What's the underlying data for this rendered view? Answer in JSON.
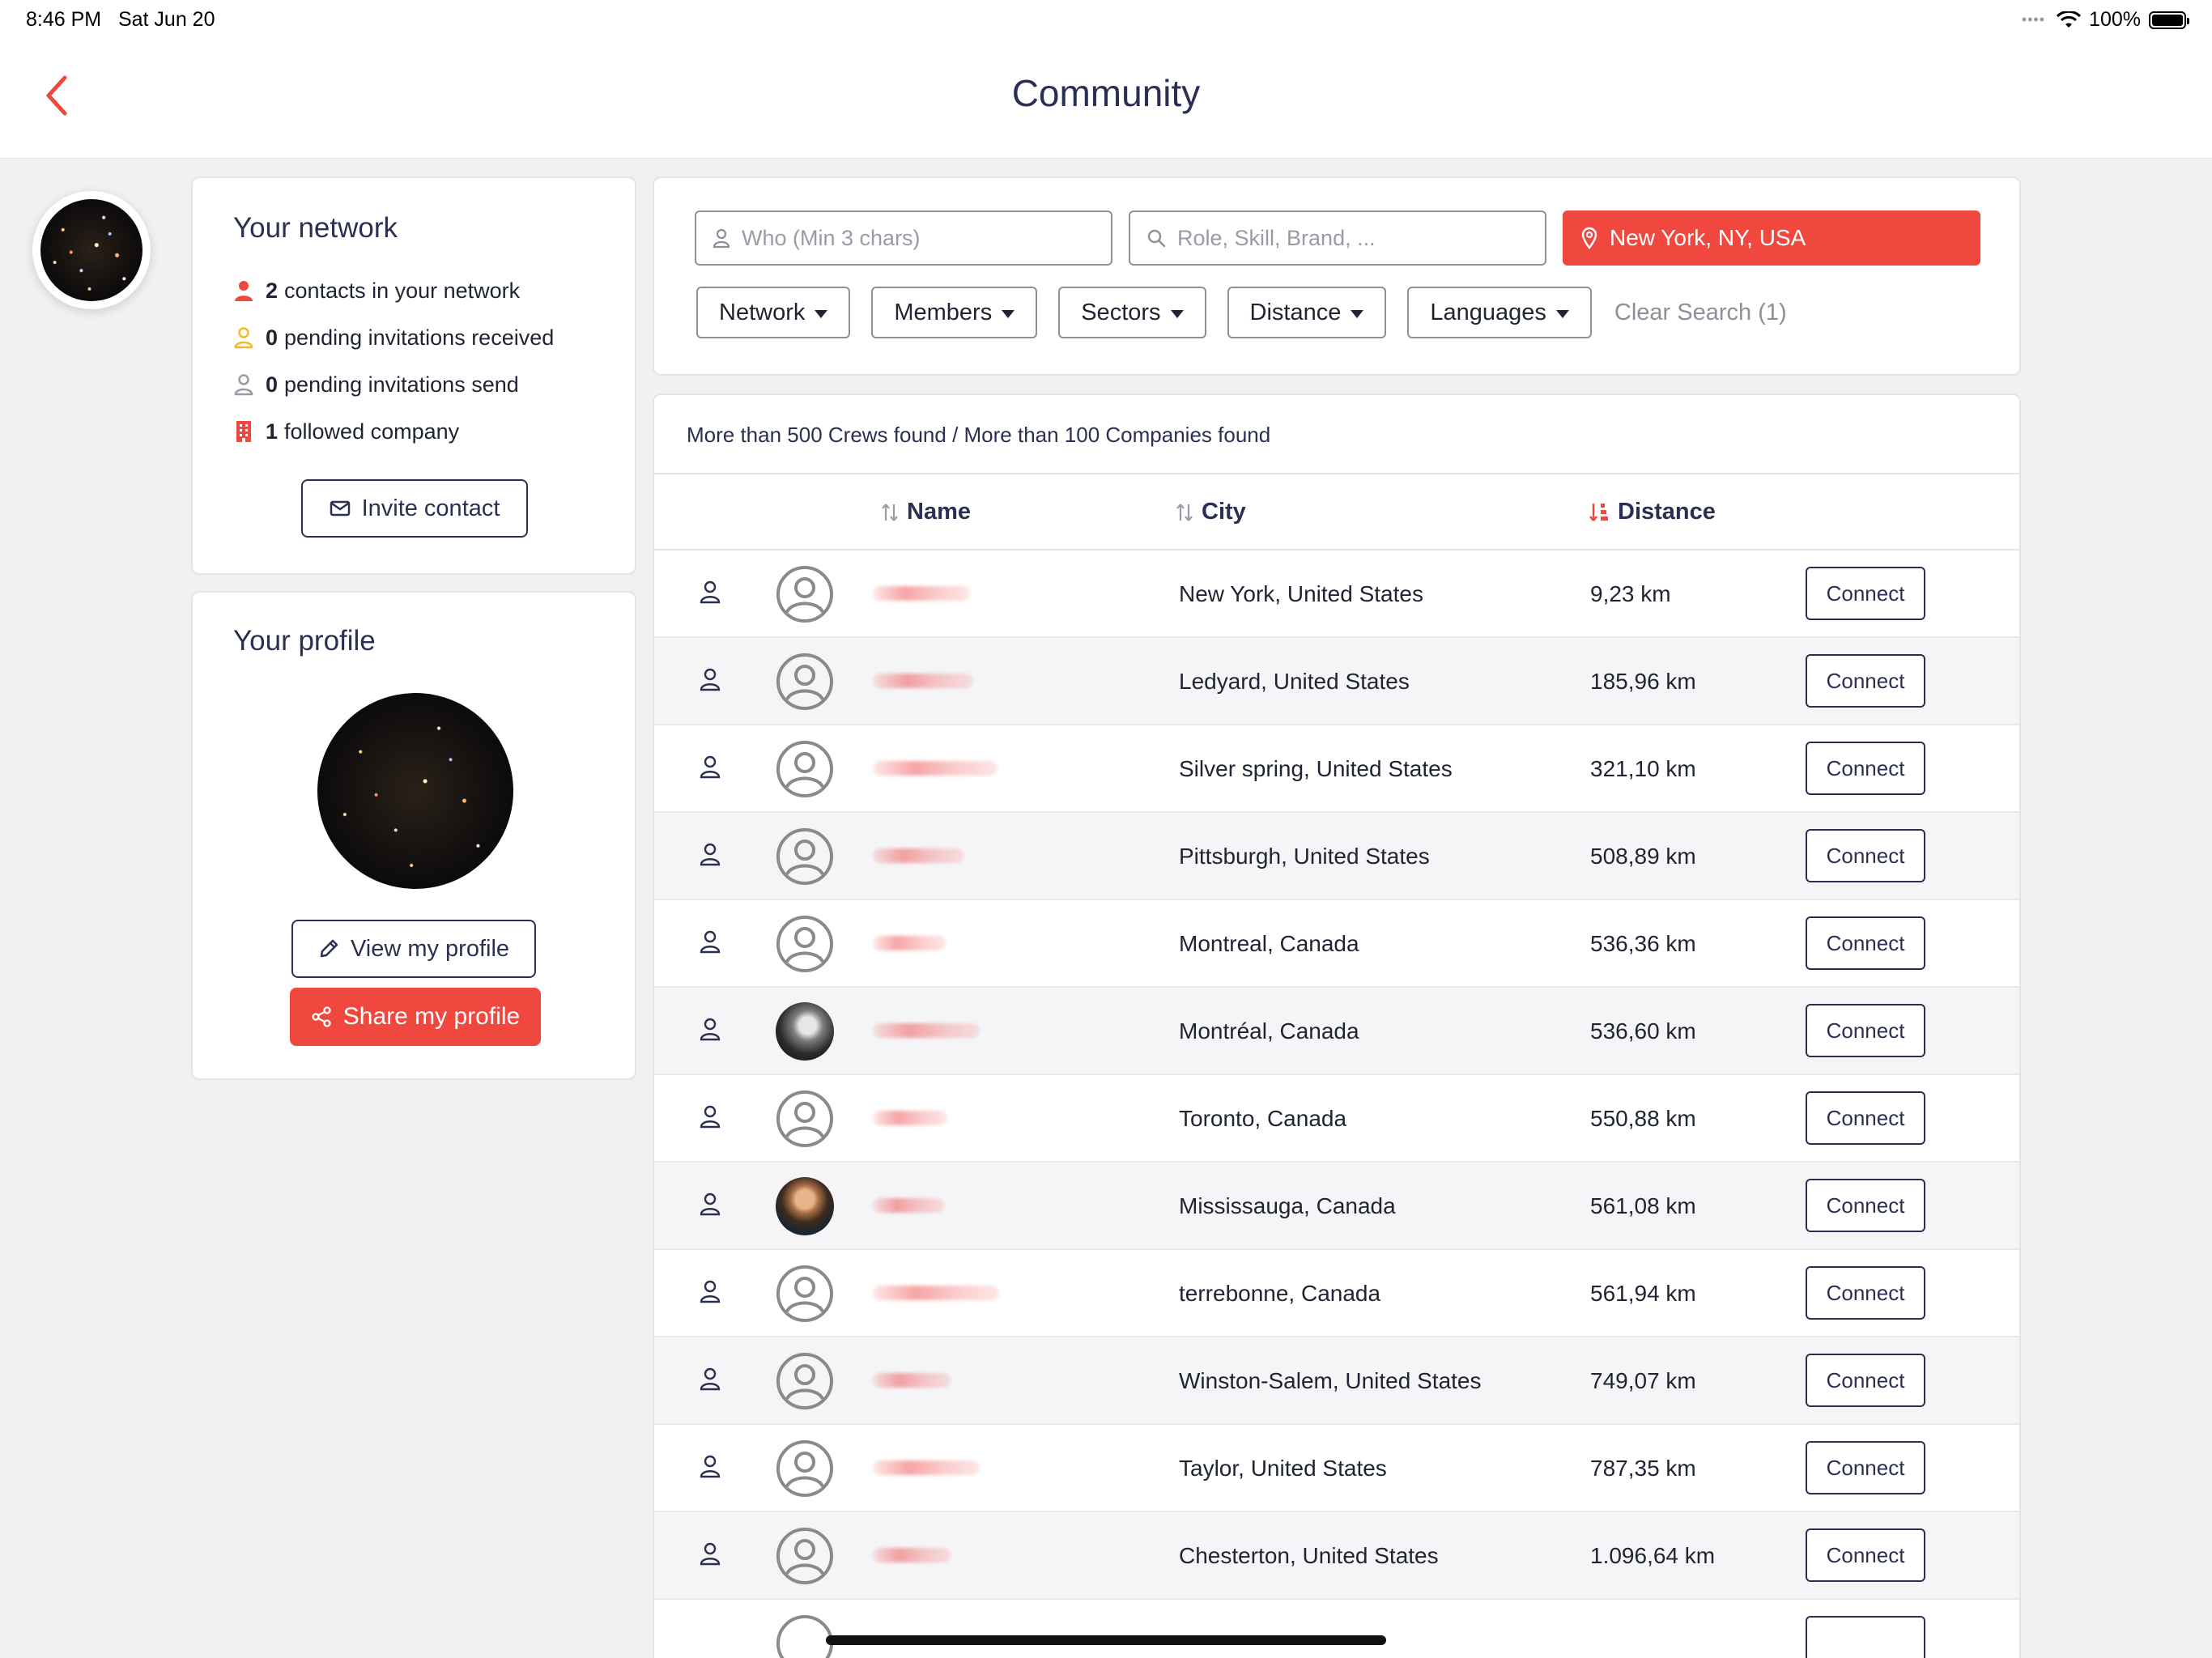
{
  "status_bar": {
    "time": "8:46 PM",
    "date": "Sat Jun 20",
    "battery": "100%"
  },
  "header": {
    "title": "Community"
  },
  "network": {
    "title": "Your network",
    "items": [
      {
        "count": "2",
        "text": "contacts in your network",
        "icon": "person-icon",
        "color": "#f0473f"
      },
      {
        "count": "0",
        "text": "pending invitations received",
        "icon": "person-outline-icon",
        "color": "#f2b928"
      },
      {
        "count": "0",
        "text": "pending invitations send",
        "icon": "person-outline-icon",
        "color": "#9a9ca5"
      },
      {
        "count": "1",
        "text": "followed company",
        "icon": "building-icon",
        "color": "#f0473f"
      }
    ],
    "invite_label": "Invite contact"
  },
  "profile": {
    "title": "Your profile",
    "view_label": "View my profile",
    "share_label": "Share my profile"
  },
  "search": {
    "who_placeholder": "Who (Min 3 chars)",
    "role_placeholder": "Role, Skill, Brand, ...",
    "location": "New York, NY, USA",
    "filters": [
      "Network",
      "Members",
      "Sectors",
      "Distance",
      "Languages"
    ],
    "clear_label": "Clear Search (1)"
  },
  "results": {
    "summary": "More than 500 Crews found / More than 100 Companies found",
    "columns": {
      "name": "Name",
      "city": "City",
      "distance": "Distance"
    },
    "connect_label": "Connect",
    "rows": [
      {
        "city": "New York, United States",
        "distance": "9,23 km",
        "avatar": "default"
      },
      {
        "city": "Ledyard, United States",
        "distance": "185,96 km",
        "avatar": "default"
      },
      {
        "city": "Silver spring, United States",
        "distance": "321,10 km",
        "avatar": "default"
      },
      {
        "city": "Pittsburgh, United States",
        "distance": "508,89 km",
        "avatar": "default"
      },
      {
        "city": "Montreal, Canada",
        "distance": "536,36 km",
        "avatar": "default"
      },
      {
        "city": "Montréal, Canada",
        "distance": "536,60 km",
        "avatar": "photo-bw"
      },
      {
        "city": "Toronto, Canada",
        "distance": "550,88 km",
        "avatar": "default"
      },
      {
        "city": "Mississauga, Canada",
        "distance": "561,08 km",
        "avatar": "photo-man"
      },
      {
        "city": "terrebonne, Canada",
        "distance": "561,94 km",
        "avatar": "default"
      },
      {
        "city": "Winston-Salem, United States",
        "distance": "749,07 km",
        "avatar": "default"
      },
      {
        "city": "Taylor, United States",
        "distance": "787,35 km",
        "avatar": "default"
      },
      {
        "city": "Chesterton, United States",
        "distance": "1.096,64 km",
        "avatar": "default"
      }
    ]
  },
  "colors": {
    "accent": "#f0473f",
    "navy": "#2b3052",
    "background": "#f1f1f3"
  }
}
